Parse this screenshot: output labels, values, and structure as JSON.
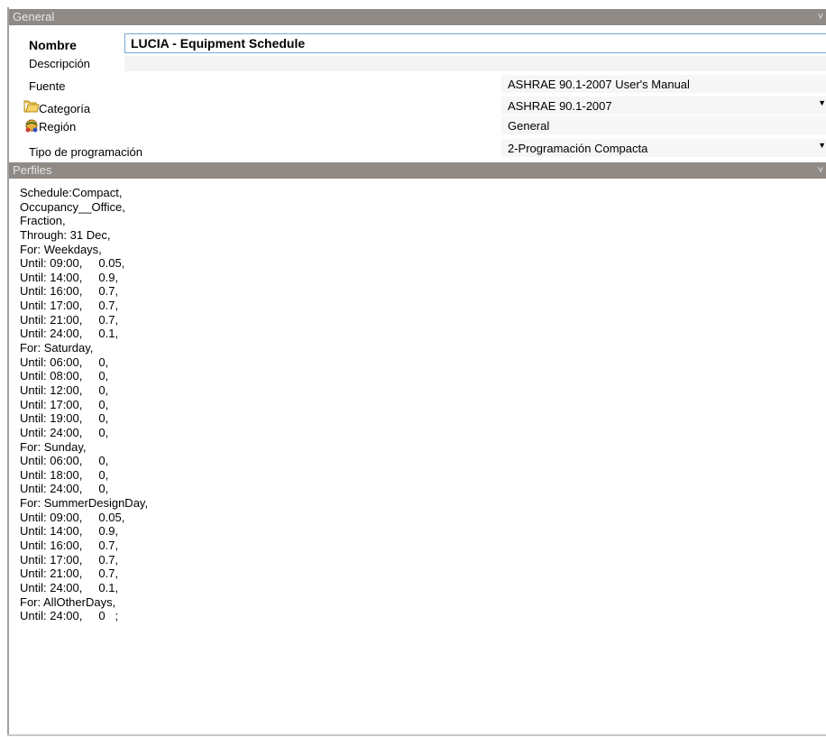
{
  "sections": {
    "general_title": "General",
    "perfiles_title": "Perfiles"
  },
  "fields": {
    "nombre_label": "Nombre",
    "nombre_value": "LUCIA - Equipment Schedule",
    "descripcion_label": "Descripción",
    "descripcion_value": "",
    "fuente_label": "Fuente",
    "fuente_value": "ASHRAE 90.1-2007 User's Manual",
    "categoria_label": "Categoría",
    "categoria_value": "ASHRAE 90.1-2007",
    "region_label": "Región",
    "region_value": "General",
    "tipo_label": "Tipo de programación",
    "tipo_value": "2-Programación Compacta"
  },
  "icons": {
    "categoria_icon": "folder-icon",
    "region_icon": "globe-people-icon",
    "collapse_icon": "chevron-collapse-icon",
    "dropdown_icon": "dropdown-arrow-icon"
  },
  "profile_lines": [
    "Schedule:Compact,",
    "Occupancy__Office,",
    "Fraction,",
    "Through: 31 Dec,",
    "For: Weekdays,",
    "Until: 09:00,     0.05,",
    "Until: 14:00,     0.9,",
    "Until: 16:00,     0.7,",
    "Until: 17:00,     0.7,",
    "Until: 21:00,     0.7,",
    "Until: 24:00,     0.1,",
    "For: Saturday,",
    "Until: 06:00,     0,",
    "Until: 08:00,     0,",
    "Until: 12:00,     0,",
    "Until: 17:00,     0,",
    "Until: 19:00,     0,",
    "Until: 24:00,     0,",
    "For: Sunday,",
    "Until: 06:00,     0,",
    "Until: 18:00,     0,",
    "Until: 24:00,     0,",
    "For: SummerDesignDay,",
    "Until: 09:00,     0.05,",
    "Until: 14:00,     0.9,",
    "Until: 16:00,     0.7,",
    "Until: 17:00,     0.7,",
    "Until: 21:00,     0.7,",
    "Until: 24:00,     0.1,",
    "For: AllOtherDays,",
    "Until: 24:00,     0   ;"
  ]
}
